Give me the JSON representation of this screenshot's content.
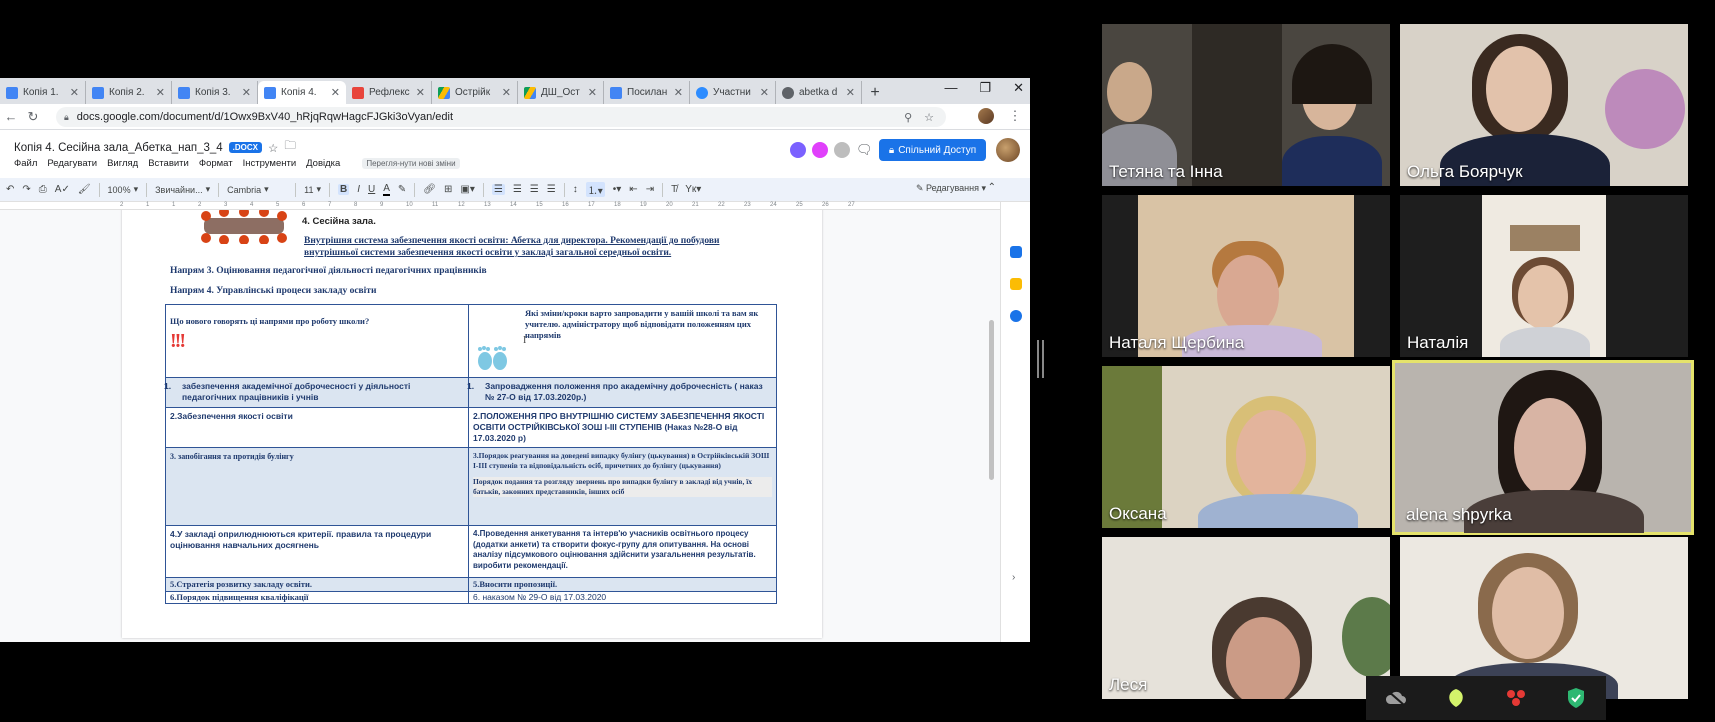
{
  "browser": {
    "tabs": [
      {
        "label": "Копія 1.",
        "color": "#4285f4",
        "active": false
      },
      {
        "label": "Копія 2.",
        "color": "#4285f4",
        "active": false
      },
      {
        "label": "Копія 3.",
        "color": "#4285f4",
        "active": false
      },
      {
        "label": "Копія 4.",
        "color": "#4285f4",
        "active": true
      },
      {
        "label": "Рефлекс",
        "color": "#e8453c",
        "active": false
      },
      {
        "label": "Острійк",
        "color": "#fbbc04",
        "active": false
      },
      {
        "label": "ДШ_Ост",
        "color": "#fbbc04",
        "active": false
      },
      {
        "label": "Посилан",
        "color": "#4285f4",
        "active": false
      },
      {
        "label": "Участни",
        "color": "#2d8cff",
        "active": false
      },
      {
        "label": "abetka d",
        "color": "#5f6368",
        "active": false
      }
    ],
    "new_tab": "+",
    "url": "docs.google.com/document/d/1Owx9BxV40_hRjqRqwHagcFJGki3oVyan/edit"
  },
  "doc": {
    "title": "Копія 4. Сесійна зала_Абетка_нап_3_4",
    "badge": ".DOCX",
    "menus": [
      "Файл",
      "Редагувати",
      "Вигляд",
      "Вставити",
      "Формат",
      "Інструменти",
      "Довідка"
    ],
    "last_edit": "Перегля-нути нові зміни",
    "share_label": "Спільний Доступ",
    "toolbar": {
      "zoom": "100%",
      "style": "Звичайни...",
      "font": "Cambria",
      "size": "11",
      "edit_mode": "Редагування"
    },
    "ruler_ticks": [
      "2",
      "1",
      "1",
      "2",
      "3",
      "4",
      "5",
      "6",
      "7",
      "8",
      "9",
      "10",
      "11",
      "12",
      "13",
      "14",
      "15",
      "16",
      "17",
      "18",
      "19",
      "20",
      "21",
      "22",
      "23",
      "24",
      "25",
      "26",
      "27"
    ],
    "list_item": "4.   Сесійна зала.",
    "heading_link": "Внутрішня система забезпечення якості освіти: Абетка для директора. Рекомендації до побудови внутрішньої системи забезпечення якості освіти у закладі загальної середньої освіти.",
    "section3": "Напрям 3. Оцінювання педагогічної діяльності педагогічних працівників",
    "section4": "Напрям 4. Управлінські процеси закладу освіти",
    "table": {
      "head_left": "Що нового говорять ці напрями про роботу школи?",
      "head_left_mark": "!!!",
      "head_right": "Які зміни/кроки варто запровадити у вашій школі та вам як учителю. адміністратору щоб відповідати положенням цих напрямів",
      "cursor": "I",
      "rows": [
        {
          "left_num": "1.",
          "left": "забезпечення академічної доброчесності у діяльності педагогічних працівників і учнів",
          "right_num": "1.",
          "right": "Запровадження положення про академічну доброчесність ( наказ № 27-О від 17.03.2020р.)"
        },
        {
          "left": "2.Забезпечення якості освіти",
          "right": "2.ПОЛОЖЕННЯ ПРО ВНУТРІШНЮ СИСТЕМУ ЗАБЕЗПЕЧЕННЯ ЯКОСТІ ОСВІТИ ОСТРІЙКІВСЬКОЇ ЗОШ І-ІІІ СТУПЕНІВ (Наказ №28-О від 17.03.2020 р)"
        },
        {
          "left": "3. запобігання та протидія булінгу",
          "right": "3.Порядок реагування на доведені випадку булінгу (цькування) в Острійківській ЗОШ І-ІІІ ступенів та відповідальність осіб, причетних до булінгу (цькування)",
          "right2": "Порядок подання та розгляду звернень про випадки булінгу в закладі від учнів, їх батьків, законних представників, інших осіб"
        },
        {
          "left": "4.У закладі оприлюднюються критерії. правила та процедури оцінювання навчальних досягнень",
          "right": "4.Проведення анкетування та інтерв'ю учасників освітнього процесу (додатки анкети) та створити фокус-групу для опитування. На основі аналізу підсумкового оцінювання здійснити узагальнення результатів. виробити рекомендації."
        },
        {
          "left": "5.Стратегія розвитку закладу освіти.",
          "right": "5.Вносити пропозиції."
        },
        {
          "left": "6.Порядок підвищення кваліфікації",
          "right": "6. наказом № 29-О від 17.03.2020"
        }
      ]
    }
  },
  "participants": [
    {
      "name": "Тетяна та Інна",
      "speaking": false
    },
    {
      "name": "Ольга Боярчук",
      "speaking": false
    },
    {
      "name": "Наталя Щербина",
      "speaking": false
    },
    {
      "name": "Наталія",
      "speaking": false
    },
    {
      "name": "Оксана",
      "speaking": false
    },
    {
      "name": "alena shpyrka",
      "speaking": true
    },
    {
      "name": "Леся",
      "speaking": false
    },
    {
      "name": "",
      "speaking": false
    }
  ],
  "controls": [
    "cloud-off-icon",
    "shield-leaf-icon",
    "reactions-icon",
    "security-check-icon"
  ],
  "colors": {
    "accent": "#1a73e8",
    "speaker": "#e5e36b",
    "doc_text": "#1f3a6e",
    "table_highlight": "#dbe5f1"
  }
}
